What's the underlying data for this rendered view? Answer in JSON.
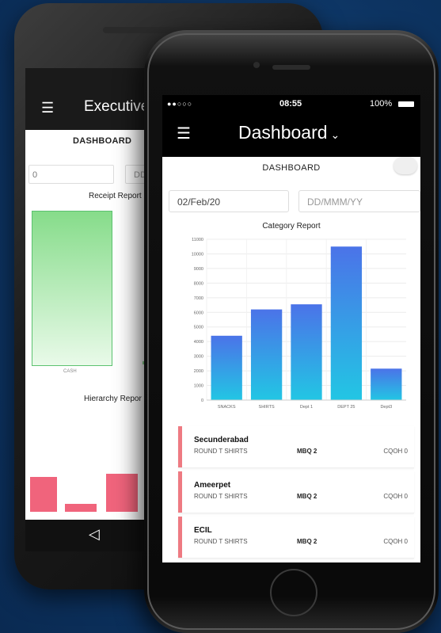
{
  "back_phone": {
    "app_title": "Executive",
    "dashboard_label": "DASHBOARD",
    "date_from_value": "0",
    "date_to_placeholder": "DD/",
    "receipt_report_title": "Receipt Report",
    "receipt_category": "CASH",
    "hierarchy_report_title": "Hierarchy Repor"
  },
  "status_bar": {
    "carrier": "●●○○○",
    "time": "08:55",
    "battery": "100%"
  },
  "nav": {
    "title": "Dashboard",
    "chevron": "⌄"
  },
  "dashboard_label": "DASHBOARD",
  "filters": {
    "date_from": "02/Feb/20",
    "date_to_placeholder": "DD/MMM/YY"
  },
  "chart_data": {
    "type": "bar",
    "title": "Category Report",
    "categories": [
      "SNACKS",
      "SHIRTS",
      "Dept 1",
      "DEPT 25",
      "Dept3"
    ],
    "values": [
      4400,
      6200,
      6550,
      10500,
      2150
    ],
    "ylim": [
      0,
      11000
    ],
    "yticks": [
      0,
      1000,
      2000,
      3000,
      4000,
      5000,
      6000,
      7000,
      8000,
      9000,
      10000,
      11000
    ],
    "grid": true,
    "colors": {
      "top": "#4b73e8",
      "bottom": "#22c6e4"
    }
  },
  "stores": [
    {
      "name": "Secunderabad",
      "product": "ROUND T SHIRTS",
      "mbq": "MBQ 2",
      "cqoh": "CQOH 0"
    },
    {
      "name": "Ameerpet",
      "product": "ROUND T SHIRTS",
      "mbq": "MBQ 2",
      "cqoh": "CQOH 0"
    },
    {
      "name": "ECIL",
      "product": "ROUND T SHIRTS",
      "mbq": "MBQ 2",
      "cqoh": "CQOH 0"
    }
  ],
  "colors": {
    "background": "#0c3260",
    "accent_stripe": "#ee7a82",
    "receipt_bar": "#86dc8a",
    "hierarchy_bar": "#f0647c"
  }
}
